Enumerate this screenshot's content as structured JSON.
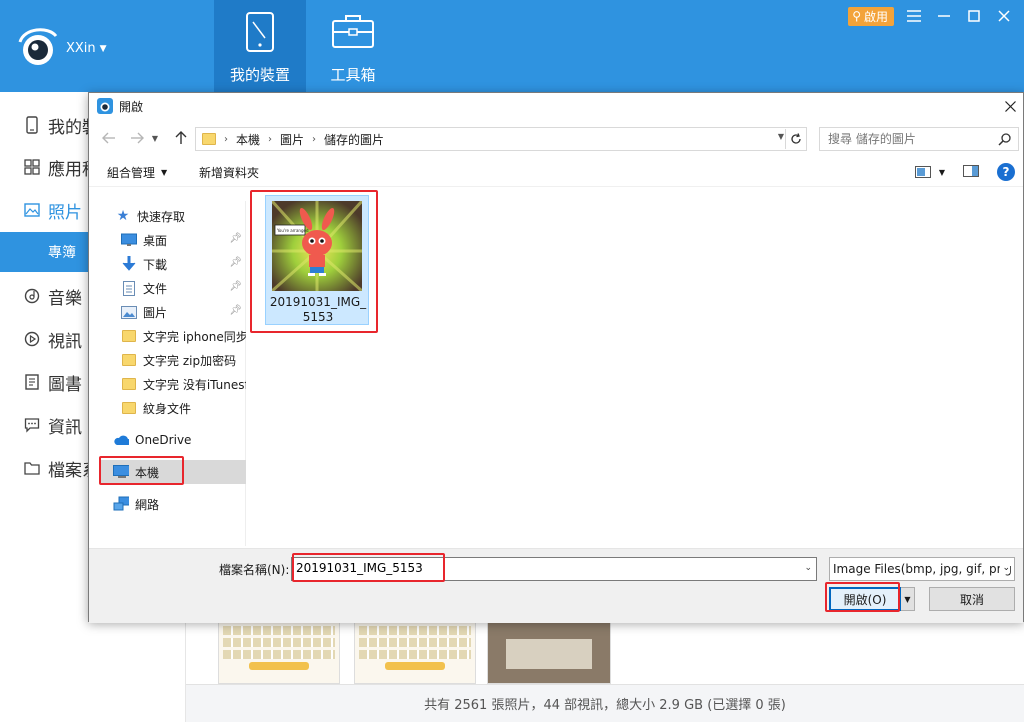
{
  "app": {
    "account_name": "XXin",
    "tabs": [
      {
        "label": "我的裝置"
      },
      {
        "label": "工具箱"
      }
    ],
    "activate_label": "啟用"
  },
  "sidebar": {
    "items": [
      {
        "label": "我的裝",
        "icon": "phone-icon"
      },
      {
        "label": "應用程",
        "icon": "apps-grid-icon"
      },
      {
        "label": "照片",
        "icon": "photo-icon"
      },
      {
        "label": "專簿",
        "icon": null
      },
      {
        "label": "音樂",
        "icon": "music-icon"
      },
      {
        "label": "視訊",
        "icon": "video-icon"
      },
      {
        "label": "圖書",
        "icon": "book-icon"
      },
      {
        "label": "資訊",
        "icon": "message-icon"
      },
      {
        "label": "檔案系",
        "icon": "folder-icon"
      }
    ]
  },
  "status_bar": {
    "text": "共有 2561 張照片，44 部視訊，總大小 2.9 GB (已選擇 0 張)"
  },
  "dialog": {
    "title": "開啟",
    "breadcrumb": [
      "本機",
      "圖片",
      "儲存的圖片"
    ],
    "search_placeholder": "搜尋 儲存的圖片",
    "organize_label": "組合管理",
    "new_folder_label": "新增資料夾",
    "nav": {
      "quick_access": "快速存取",
      "pinned": [
        {
          "label": "桌面",
          "icon": "desktop-icon"
        },
        {
          "label": "下載",
          "icon": "download-icon"
        },
        {
          "label": "文件",
          "icon": "document-icon"
        },
        {
          "label": "圖片",
          "icon": "pictures-icon"
        }
      ],
      "folders": [
        {
          "label": "文字完 iphone同步"
        },
        {
          "label": "文字完 zip加密码"
        },
        {
          "label": "文字完 没有iTunesf"
        },
        {
          "label": "紋身文件"
        }
      ],
      "onedrive": "OneDrive",
      "this_pc": "本機",
      "network": "網路"
    },
    "file": {
      "name": "20191031_IMG_5153",
      "thumb_text": "You're arranged"
    },
    "filename_label": "檔案名稱(N):",
    "filename_value": "20191031_IMG_5153",
    "filetype_value": "Image Files(bmp, jpg, gif, png",
    "open_label": "開啟(O)",
    "cancel_label": "取消"
  },
  "colors": {
    "header_blue": "#2f93e0",
    "header_active": "#1f7bc8",
    "highlight_red": "#e8262d",
    "selection_blue": "#cce8ff",
    "activate_orange": "#f3a33a"
  }
}
